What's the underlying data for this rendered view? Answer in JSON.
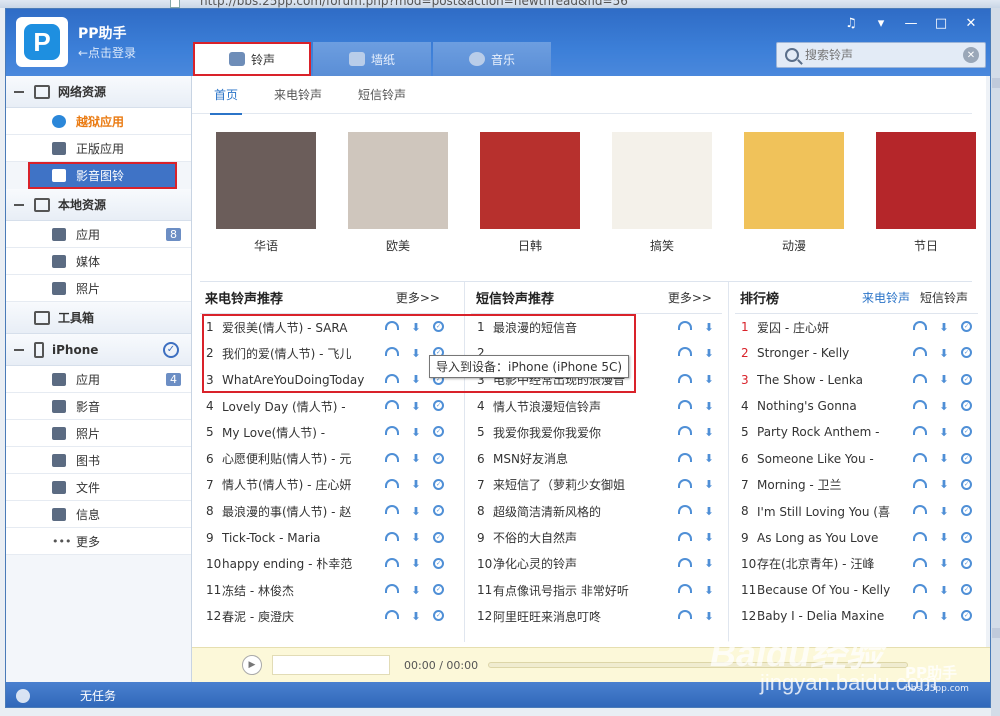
{
  "browser": {
    "url_fragment": "http://bbs.25pp.com/forum.php?mod=post&action=newthread&fid=56"
  },
  "app": {
    "name": "PP助手",
    "login": "←点击登录",
    "logo_letter": "P"
  },
  "tabs": [
    {
      "label": "铃声",
      "icon": "bell-icon",
      "active": true
    },
    {
      "label": "墙纸",
      "icon": "picture-icon",
      "active": false
    },
    {
      "label": "音乐",
      "icon": "music-disc-icon",
      "active": false
    }
  ],
  "window_controls": [
    "♫",
    "▾",
    "—",
    "□",
    "✕"
  ],
  "search": {
    "placeholder": "搜索铃声",
    "clear": "✕"
  },
  "sidebar": {
    "network": {
      "title": "网络资源",
      "items": [
        {
          "label": "越狱应用",
          "icon": "pp-icon"
        },
        {
          "label": "正版应用",
          "icon": "stamp-icon"
        },
        {
          "label": "影音图铃",
          "icon": "music-note-icon"
        }
      ]
    },
    "local": {
      "title": "本地资源",
      "items": [
        {
          "label": "应用",
          "badge": "8",
          "icon": "grid-icon"
        },
        {
          "label": "媒体",
          "badge": "",
          "icon": "film-icon"
        },
        {
          "label": "照片",
          "badge": "",
          "icon": "photo-icon"
        }
      ]
    },
    "toolbox": {
      "title": "工具箱"
    },
    "iphone": {
      "title": "iPhone",
      "items": [
        {
          "label": "应用",
          "badge": "4",
          "icon": "grid-icon"
        },
        {
          "label": "影音",
          "badge": "",
          "icon": "film-icon"
        },
        {
          "label": "照片",
          "badge": "",
          "icon": "photo-icon"
        },
        {
          "label": "图书",
          "badge": "",
          "icon": "book-icon"
        },
        {
          "label": "文件",
          "badge": "",
          "icon": "file-icon"
        },
        {
          "label": "信息",
          "badge": "",
          "icon": "message-icon"
        },
        {
          "label": "更多",
          "badge": "",
          "icon": "dots-icon"
        }
      ]
    },
    "footer": "无任务"
  },
  "subtabs": [
    "首页",
    "来电铃声",
    "短信铃声"
  ],
  "categories": [
    {
      "label": "华语",
      "thumb_color": "#6b5d5a"
    },
    {
      "label": "欧美",
      "thumb_color": "#cfc6bd"
    },
    {
      "label": "日韩",
      "thumb_color": "#b7302d"
    },
    {
      "label": "搞笑",
      "thumb_color": "#f4f1ea"
    },
    {
      "label": "动漫",
      "thumb_color": "#f0c25a"
    },
    {
      "label": "节日",
      "thumb_color": "#b5262a"
    }
  ],
  "lists": {
    "call": {
      "title": "来电铃声推荐",
      "more": "更多>>",
      "rows": [
        "爱很美(情人节) - SARA",
        "我们的爱(情人节) - 飞儿",
        "WhatAreYouDoingToday",
        "Lovely Day (情人节) -",
        "My Love(情人节) -",
        "心愿便利贴(情人节) - 元",
        "情人节(情人节) - 庄心妍",
        "最浪漫的事(情人节) - 赵",
        "Tick-Tock - Maria",
        "happy ending - 朴幸范",
        "冻结 - 林俊杰",
        "春泥 - 庾澄庆"
      ]
    },
    "sms": {
      "title": "短信铃声推荐",
      "more": "更多>>",
      "rows": [
        "最浪漫的短信音",
        "",
        "电影中经常出现的浪漫音",
        "情人节浪漫短信铃声",
        "我爱你我爱你我爱你",
        "MSN好友消息",
        "来短信了（萝莉少女御姐",
        "超级简洁清新风格的",
        "不俗的大自然声",
        "净化心灵的铃声",
        "有点像讯号指示 非常好听",
        "阿里旺旺来消息叮咚"
      ]
    },
    "rank": {
      "title": "排行榜",
      "tab_call": "来电铃声",
      "tab_sms": "短信铃声",
      "rows": [
        "爱囚 - 庄心妍",
        "Stronger - Kelly",
        "The Show - Lenka",
        "Nothing's Gonna",
        "Party Rock Anthem -",
        "Someone Like You -",
        "Morning - 卫兰",
        "I'm Still Loving You (喜",
        "As Long as You Love",
        "存在(北京青年) - 汪峰",
        "Because Of You - Kelly",
        "Baby I - Delia Maxine"
      ]
    }
  },
  "tooltip": "导入到设备：iPhone (iPhone 5C)",
  "player": {
    "time": "00:00 / 00:00",
    "progress": 0
  },
  "watermark": {
    "brand": "Baidu经验",
    "site": "jingyan.baidu.com",
    "pp": "PP助手",
    "pp_site": "bbs.25pp.com"
  }
}
